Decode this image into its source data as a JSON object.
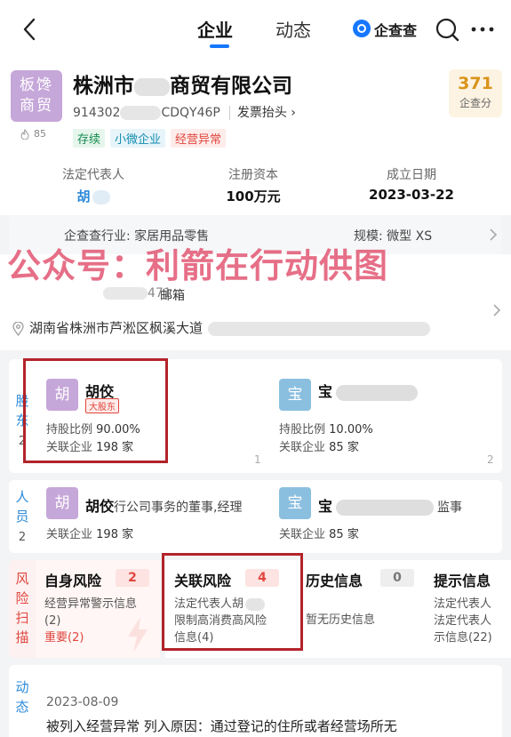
{
  "nav": {
    "tabs": [
      "企业",
      "动态"
    ],
    "brand": "企查查"
  },
  "company": {
    "logo_text": [
      "板馋",
      "商贸"
    ],
    "heat": "85",
    "name": "株洲市",
    "name_suffix": "商贸有限公司",
    "credit_code_prefix": "914302",
    "credit_code_suffix": "CDQY46P",
    "invoice_label": "发票抬头",
    "tags": [
      "存续",
      "小微企业",
      "经营异常"
    ],
    "score": "371",
    "score_label": "企查分",
    "legal_rep_label": "法定代表人",
    "legal_rep_value": "胡",
    "capital_label": "注册资本",
    "capital_value": "100万元",
    "founded_label": "成立日期",
    "founded_value": "2023-03-22"
  },
  "industry": {
    "text": "企查查行业: 家居用品零售",
    "scale": "规模: 微型 XS"
  },
  "watermark": "公众号：利箭在行动供图",
  "contact": {
    "phone": "471",
    "email_label": "邮箱",
    "address": "湖南省株洲市芦淞区枫溪大道"
  },
  "shareholders": {
    "label": "股东",
    "count": "2",
    "items": [
      {
        "avatar": "胡",
        "name": "胡佼",
        "badge": "大股东",
        "ratio_label": "持股比例",
        "ratio": "90.00%",
        "assoc_label": "关联企业",
        "assoc": "198 家",
        "index": "1"
      },
      {
        "avatar": "宝",
        "name": "宝",
        "ratio_label": "持股比例",
        "ratio": "10.00%",
        "assoc_label": "关联企业",
        "assoc": "85 家",
        "index": "2"
      }
    ]
  },
  "personnel": {
    "label": "人员",
    "count": "2",
    "items": [
      {
        "avatar": "胡",
        "name": "胡佼",
        "role": "行公司事务的董事,经理",
        "assoc_label": "关联企业",
        "assoc": "198 家"
      },
      {
        "avatar": "宝",
        "name": "宝",
        "role": "监事",
        "assoc_label": "关联企业",
        "assoc": "85 家"
      }
    ]
  },
  "risk": {
    "label": "风险扫描",
    "panels": [
      {
        "title": "自身风险",
        "count": "2",
        "lines": [
          "经营异常警示信息",
          "(2)",
          "重要(2)"
        ]
      },
      {
        "title": "关联风险",
        "count": "4",
        "lines": [
          "法定代表人胡",
          "限制高消费高风险",
          "信息(4)"
        ]
      },
      {
        "title": "历史信息",
        "count": "0",
        "lines": [
          "暂无历史信息"
        ]
      },
      {
        "title": "提示信息",
        "lines": [
          "法定代表人",
          "法定代表人",
          "示信息(22)"
        ]
      }
    ]
  },
  "dynamics": {
    "label": "动态",
    "date": "2023-08-09",
    "text": "被列入经营异常   列入原因：通过登记的住所或者经营场所无"
  },
  "colors": {
    "accent": "#1677ff",
    "risk_red": "#e0463e",
    "annotation_box": "#b3232a",
    "watermark": "#e25773"
  }
}
